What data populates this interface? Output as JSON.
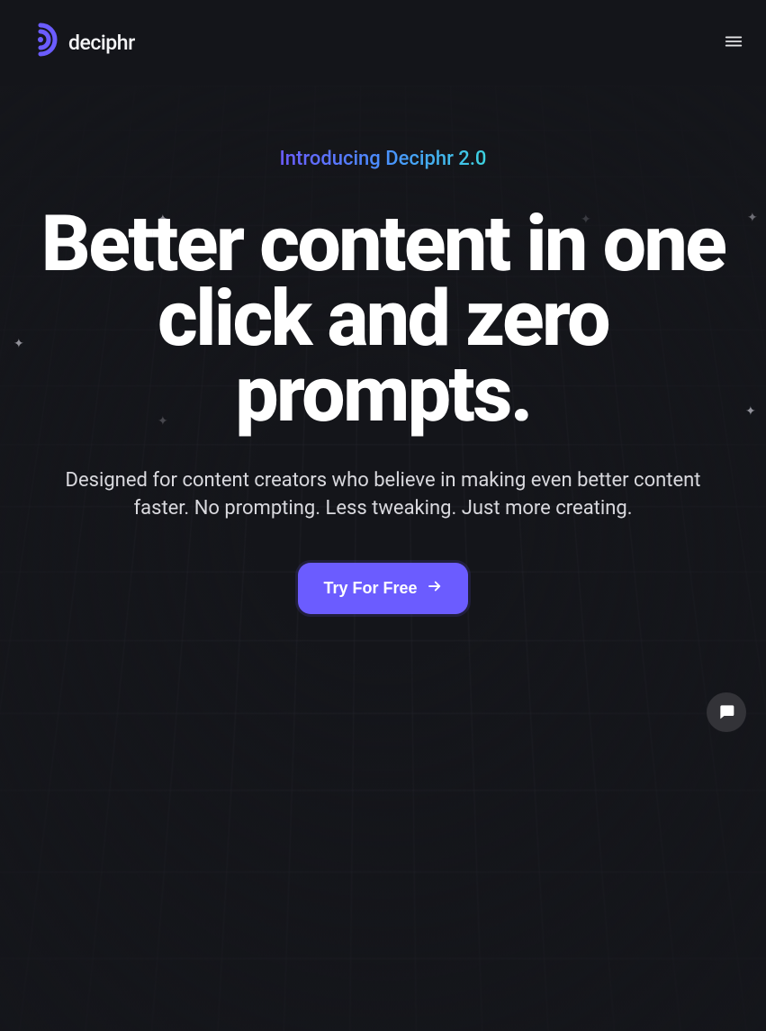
{
  "brand": {
    "name": "deciphr",
    "accent_color": "#6b5cff"
  },
  "hero": {
    "eyebrow": "Introducing Deciphr 2.0",
    "headline": "Better content in one click and zero prompts.",
    "subhead": "Designed for content creators who believe in making even better content faster. No prompting. Less tweaking. Just more creating.",
    "cta_label": "Try For Free"
  }
}
